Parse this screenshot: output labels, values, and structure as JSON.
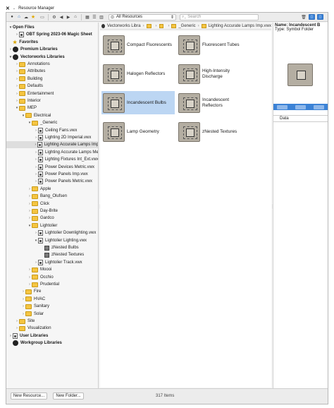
{
  "titlebar": {
    "close": "✕",
    "chevron": "⌄",
    "title": "Resource Manager"
  },
  "toolbar": {
    "resource_filter": "All Resources",
    "search_placeholder": "Search"
  },
  "tree": [
    {
      "label": "Open Files",
      "indent": 0,
      "twisty": "▾",
      "icon": "none",
      "bold": true
    },
    {
      "label": "OBT Spring 2023-06 Magic Sheet",
      "indent": 1,
      "twisty": "›",
      "icon": "file",
      "bold": true
    },
    {
      "label": "Favorites",
      "indent": 0,
      "twisty": "",
      "icon": "star",
      "bold": true
    },
    {
      "label": "Premium Libraries",
      "indent": 0,
      "twisty": "›",
      "icon": "globe",
      "bold": true
    },
    {
      "label": "Vectorworks Libraries",
      "indent": 0,
      "twisty": "▾",
      "icon": "globe",
      "bold": true
    },
    {
      "label": "Annotations",
      "indent": 1,
      "twisty": "›",
      "icon": "folder"
    },
    {
      "label": "Attributes",
      "indent": 1,
      "twisty": "›",
      "icon": "folder"
    },
    {
      "label": "Building",
      "indent": 1,
      "twisty": "›",
      "icon": "folder"
    },
    {
      "label": "Defaults",
      "indent": 1,
      "twisty": "›",
      "icon": "folder"
    },
    {
      "label": "Entertainment",
      "indent": 1,
      "twisty": "›",
      "icon": "folder"
    },
    {
      "label": "Interior",
      "indent": 1,
      "twisty": "›",
      "icon": "folder"
    },
    {
      "label": "MEP",
      "indent": 1,
      "twisty": "▾",
      "icon": "folder"
    },
    {
      "label": "Electrical",
      "indent": 2,
      "twisty": "▾",
      "icon": "folder"
    },
    {
      "label": "_Generic",
      "indent": 3,
      "twisty": "▾",
      "icon": "folder"
    },
    {
      "label": "Ceiling Fans.vwx",
      "indent": 4,
      "twisty": "›",
      "icon": "file"
    },
    {
      "label": "Lighting 2D Imperial.vwx",
      "indent": 4,
      "twisty": "›",
      "icon": "file"
    },
    {
      "label": "Lighting Accurate Lamps Imp",
      "indent": 4,
      "twisty": "›",
      "icon": "file",
      "selected": true
    },
    {
      "label": "Lighting Accurate Lamps Me",
      "indent": 4,
      "twisty": "›",
      "icon": "file"
    },
    {
      "label": "Lighting Fixtures Int_Ext.vwx",
      "indent": 4,
      "twisty": "›",
      "icon": "file"
    },
    {
      "label": "Power Devices Metric.vwx",
      "indent": 4,
      "twisty": "›",
      "icon": "file"
    },
    {
      "label": "Power Panels Imp.vwx",
      "indent": 4,
      "twisty": "›",
      "icon": "file"
    },
    {
      "label": "Power Panels Metric.vwx",
      "indent": 4,
      "twisty": "›",
      "icon": "file"
    },
    {
      "label": "Apple",
      "indent": 3,
      "twisty": "›",
      "icon": "folder"
    },
    {
      "label": "Bang_Olufsen",
      "indent": 3,
      "twisty": "›",
      "icon": "folder"
    },
    {
      "label": "Click",
      "indent": 3,
      "twisty": "›",
      "icon": "folder"
    },
    {
      "label": "Day-Brite",
      "indent": 3,
      "twisty": "›",
      "icon": "folder"
    },
    {
      "label": "Gardco",
      "indent": 3,
      "twisty": "›",
      "icon": "folder"
    },
    {
      "label": "Lightolier",
      "indent": 3,
      "twisty": "▾",
      "icon": "folder"
    },
    {
      "label": "Lightolier Downlighting.vwx",
      "indent": 4,
      "twisty": "›",
      "icon": "file"
    },
    {
      "label": "Lightolier Lighting.vwx",
      "indent": 4,
      "twisty": "▾",
      "icon": "file"
    },
    {
      "label": "zNested Bulbs",
      "indent": 5,
      "twisty": "",
      "icon": "symbol"
    },
    {
      "label": "zNested Textures",
      "indent": 5,
      "twisty": "",
      "icon": "symbol"
    },
    {
      "label": "Lightolier Track.vwx",
      "indent": 4,
      "twisty": "›",
      "icon": "file"
    },
    {
      "label": "Moooi",
      "indent": 3,
      "twisty": "›",
      "icon": "folder"
    },
    {
      "label": "Occhio",
      "indent": 3,
      "twisty": "›",
      "icon": "folder"
    },
    {
      "label": "Prudential",
      "indent": 3,
      "twisty": "›",
      "icon": "folder"
    },
    {
      "label": "Fire",
      "indent": 2,
      "twisty": "›",
      "icon": "folder"
    },
    {
      "label": "HVAC",
      "indent": 2,
      "twisty": "›",
      "icon": "folder"
    },
    {
      "label": "Sanitary",
      "indent": 2,
      "twisty": "›",
      "icon": "folder"
    },
    {
      "label": "Solar",
      "indent": 2,
      "twisty": "›",
      "icon": "folder"
    },
    {
      "label": "Site",
      "indent": 1,
      "twisty": "›",
      "icon": "folder"
    },
    {
      "label": "Visualization",
      "indent": 1,
      "twisty": "›",
      "icon": "folder"
    },
    {
      "label": "User Libraries",
      "indent": 0,
      "twisty": "›",
      "icon": "file",
      "bold": true
    },
    {
      "label": "Workgroup Libraries",
      "indent": 0,
      "twisty": "",
      "icon": "globe",
      "bold": true
    }
  ],
  "breadcrumb": [
    "Vectorworks Libra",
    "",
    "",
    "_Generic",
    "Lighting Accurate Lamps Imp.vwx"
  ],
  "resources": [
    {
      "label": "Compact Fluorescents"
    },
    {
      "label": "Fluorescent Tubes"
    },
    {
      "label": "Halogen Reflectors"
    },
    {
      "label": "High-Intensity Discharge"
    },
    {
      "label": "Incandescent Bulbs",
      "selected": true
    },
    {
      "label": "Incandescent Reflectors"
    },
    {
      "label": "Lamp Geometry"
    },
    {
      "label": "zNested Textures"
    }
  ],
  "info": {
    "name": "Name: Incandescent B",
    "type": "Type: Symbol Folder",
    "data_label": "Data"
  },
  "footer": {
    "new_resource": "New Resource...",
    "new_folder": "New Folder...",
    "item_count": "317 Items"
  },
  "colors": {
    "accent": "#3b82d6",
    "selection": "#bcd6f3",
    "folder": "#f5c542"
  }
}
